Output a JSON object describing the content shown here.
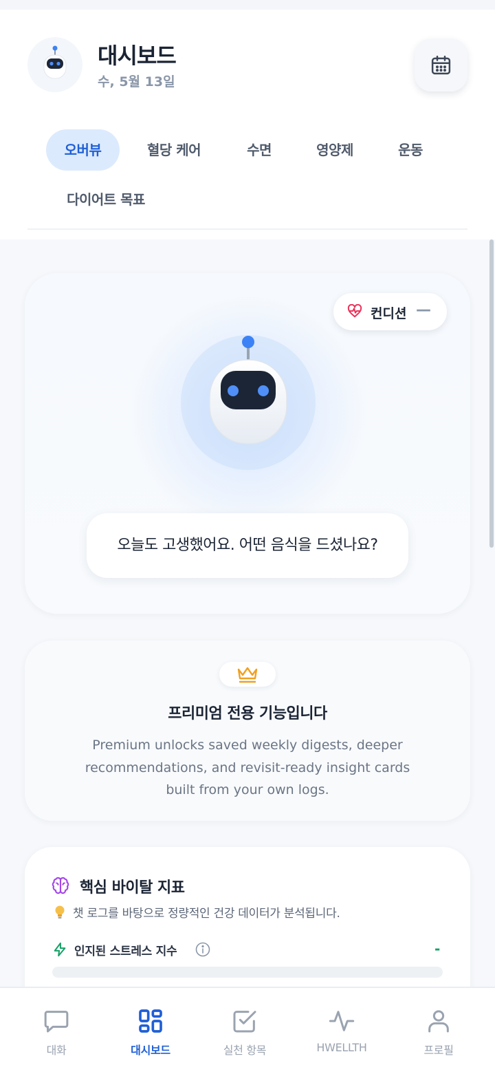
{
  "header": {
    "title": "대시보드",
    "date": "수, 5월 13일",
    "avatar_icon": "robot-icon",
    "calendar_icon": "calendar-icon"
  },
  "tabs": [
    {
      "label": "오버뷰",
      "active": true
    },
    {
      "label": "혈당 케어",
      "active": false
    },
    {
      "label": "수면",
      "active": false
    },
    {
      "label": "영양제",
      "active": false
    },
    {
      "label": "운동",
      "active": false
    },
    {
      "label": "다이어트 목표",
      "active": false
    }
  ],
  "hero": {
    "condition_label": "컨디션",
    "condition_value": "—",
    "condition_icon": "heart-pulse-icon",
    "message": "오늘도 고생했어요. 어떤 음식을 드셨나요?"
  },
  "premium": {
    "icon": "crown-icon",
    "title": "프리미엄 전용 기능입니다",
    "description": "Premium unlocks saved weekly digests, deeper recommendations, and revisit-ready insight cards built from your own logs."
  },
  "vitals": {
    "title": "핵심 바이탈 지표",
    "subtitle": "챗 로그를 바탕으로 정량적인 건강 데이터가 분석됩니다.",
    "stress_label": "인지된 스트레스 지수",
    "stress_value": "-"
  },
  "bottom_nav": [
    {
      "label": "대화",
      "icon": "chat-icon",
      "active": false
    },
    {
      "label": "대시보드",
      "icon": "dashboard-icon",
      "active": true
    },
    {
      "label": "실천 항목",
      "icon": "checklist-icon",
      "active": false
    },
    {
      "label": "HWELLTH",
      "icon": "activity-icon",
      "active": false
    },
    {
      "label": "프로필",
      "icon": "profile-icon",
      "active": false
    }
  ],
  "colors": {
    "accent": "#1f5fd6",
    "accent_bg": "#dceafd",
    "heart": "#e8335a",
    "crown": "#f0a020",
    "brain": "#a445e8",
    "bolt": "#16a066"
  }
}
